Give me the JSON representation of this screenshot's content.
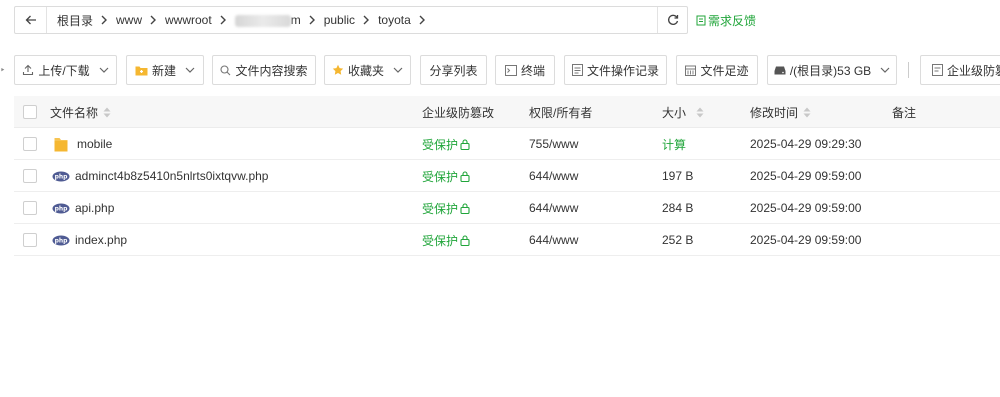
{
  "breadcrumb": {
    "items": [
      "根目录",
      "www",
      "wwwroot",
      "m",
      "public",
      "toyota"
    ]
  },
  "feedback_label": "需求反馈",
  "toolbar": {
    "upload_label": "上传/下载",
    "new_label": "新建",
    "search_content_label": "文件内容搜索",
    "favorites_label": "收藏夹",
    "share_list_label": "分享列表",
    "terminal_label": "终端",
    "file_log_label": "文件操作记录",
    "file_trace_label": "文件足迹",
    "disk_label": "/(根目录)53 GB",
    "enterprise_label": "企业级防篡"
  },
  "table": {
    "headers": {
      "name": "文件名称",
      "tamper": "企业级防篡改",
      "perm": "权限/所有者",
      "size": "大小",
      "mtime": "修改时间",
      "note": "备注"
    },
    "rows": [
      {
        "name": "mobile",
        "type": "folder",
        "tamper": "受保护",
        "perm": "755/www",
        "size": "计算",
        "mtime": "2025-04-29 09:29:30"
      },
      {
        "name": "adminct4b8z5410n5nlrts0ixtqvw.php",
        "type": "php",
        "tamper": "受保护",
        "perm": "644/www",
        "size": "197 B",
        "mtime": "2025-04-29 09:59:00"
      },
      {
        "name": "api.php",
        "type": "php",
        "tamper": "受保护",
        "perm": "644/www",
        "size": "284 B",
        "mtime": "2025-04-29 09:59:00"
      },
      {
        "name": "index.php",
        "type": "php",
        "tamper": "受保护",
        "perm": "644/www",
        "size": "252 B",
        "mtime": "2025-04-29 09:59:00"
      }
    ]
  },
  "colors": {
    "accent_green": "#20a53a",
    "header_bg": "#f7f7f7",
    "border": "#dcdcdc"
  },
  "icons": {
    "back": "arrow-left-icon",
    "refresh": "refresh-icon",
    "feedback": "feedback-icon",
    "upload": "upload-icon",
    "new": "folder-new-icon",
    "search": "search-icon",
    "favorites": "star-icon",
    "terminal": "terminal-icon",
    "file_log": "file-log-icon",
    "file_trace": "calendar-icon",
    "disk": "disk-icon",
    "enterprise": "shield-doc-icon",
    "lock": "lock-icon",
    "folder": "folder-icon",
    "php": "php-file-icon"
  }
}
